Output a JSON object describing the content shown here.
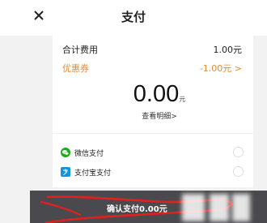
{
  "header": {
    "close_icon": "close-icon",
    "title": "支付"
  },
  "summary": {
    "total_label": "合计费用",
    "total_value": "1.00元",
    "coupon_label": "优惠券",
    "coupon_value": "-1.00元 >"
  },
  "amount": {
    "value": "0.00",
    "unit": "元",
    "details_link": "查看明细>"
  },
  "payment_methods": [
    {
      "label": "微信支付",
      "icon": "wechat-pay-icon",
      "color": "#1aad19"
    },
    {
      "label": "支付宝支付",
      "icon": "alipay-icon",
      "color": "#1296db"
    }
  ],
  "confirm": {
    "label": "确认支付0.00元"
  },
  "colors": {
    "accent_orange": "#e88a2d",
    "confirm_bg": "#4a4a4e",
    "scribble_red": "#e0201e"
  }
}
